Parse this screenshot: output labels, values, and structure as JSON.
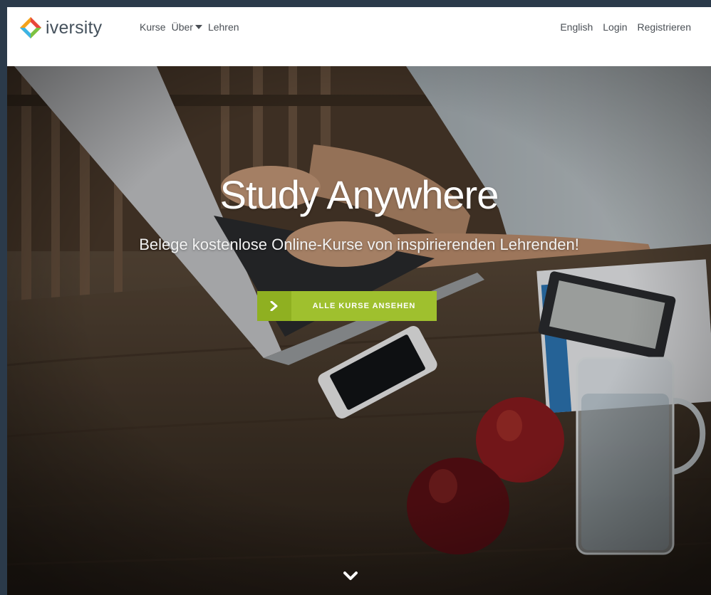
{
  "brand": {
    "name": "iversity"
  },
  "nav": {
    "left": [
      {
        "label": "Kurse"
      },
      {
        "label": "Über"
      },
      {
        "label": "Lehren"
      }
    ],
    "right": [
      {
        "label": "English"
      },
      {
        "label": "Login"
      },
      {
        "label": "Registrieren"
      }
    ]
  },
  "hero": {
    "title": "Study Anywhere",
    "subtitle": "Belege kostenlose Online-Kurse von inspirierenden Lehrenden!",
    "cta_label": "ALLE KURSE ANSEHEN"
  },
  "colors": {
    "accent": "#9fc02e",
    "accent_dark": "#8fb021",
    "nav_text": "#4a4f55"
  },
  "icons": {
    "cta": "chevron-right-icon",
    "scroll": "chevron-down-icon",
    "dropdown": "caret-down-icon"
  }
}
